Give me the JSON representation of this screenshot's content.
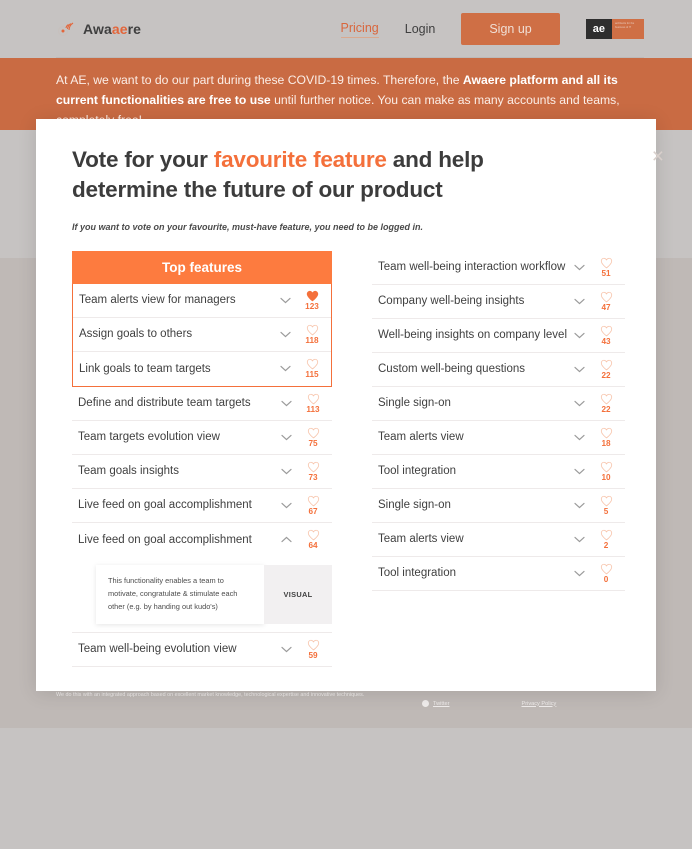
{
  "nav": {
    "brand": "Awa",
    "brand_accent": "ae",
    "brand_tail": "re",
    "pricing": "Pricing",
    "login": "Login",
    "signup": "Sign up",
    "ae_badge": "ae",
    "ae_tagline": "architects for the business of IT"
  },
  "banner": {
    "part1": "At AE, we want to do our part during these COVID-19 times. Therefore, the ",
    "bold1": "Awaere platform and all its current functionalities are free to use",
    "part2": " until further notice. You can make as many accounts and teams, completely free!"
  },
  "modal": {
    "title_part1": "Vote for your ",
    "title_accent": "favourite feature",
    "title_part2": " and help determine the future of our product",
    "subtitle": "If you want to vote on your favourite, must-have feature, you need to be logged in.",
    "close": "×",
    "top_features_header": "Top features",
    "detail": {
      "text": "This functionality enables a team to motivate, congratulate & stimulate each other (e.g. by handing out kudo's)",
      "visual_label": "VISUAL"
    },
    "left_column": [
      {
        "label": "Team alerts view for managers",
        "votes": "123",
        "voted": true,
        "expanded": false
      },
      {
        "label": "Assign goals to others",
        "votes": "118",
        "voted": false,
        "expanded": false
      },
      {
        "label": "Link goals to team targets",
        "votes": "115",
        "voted": false,
        "expanded": false
      },
      {
        "label": "Define and distribute team targets",
        "votes": "113",
        "voted": false,
        "expanded": false
      },
      {
        "label": "Team targets evolution view",
        "votes": "75",
        "voted": false,
        "expanded": false
      },
      {
        "label": "Team goals insights",
        "votes": "73",
        "voted": false,
        "expanded": false
      },
      {
        "label": "Live feed on goal accomplishment",
        "votes": "67",
        "voted": false,
        "expanded": false
      },
      {
        "label": "Live feed on goal accomplishment",
        "votes": "64",
        "voted": false,
        "expanded": true
      },
      {
        "label": "Team well-being evolution view",
        "votes": "59",
        "voted": false,
        "expanded": false
      }
    ],
    "right_column": [
      {
        "label": "Team well-being interaction workflow",
        "votes": "51",
        "voted": false
      },
      {
        "label": "Company well-being insights",
        "votes": "47",
        "voted": false
      },
      {
        "label": "Well-being insights on company level",
        "votes": "43",
        "voted": false
      },
      {
        "label": "Custom well-being questions",
        "votes": "22",
        "voted": false
      },
      {
        "label": "Single sign-on",
        "votes": "22",
        "voted": false
      },
      {
        "label": "Team alerts view",
        "votes": "18",
        "voted": false
      },
      {
        "label": "Tool integration",
        "votes": "10",
        "voted": false
      },
      {
        "label": "Single sign-on",
        "votes": "5",
        "voted": false
      },
      {
        "label": "Team alerts view",
        "votes": "2",
        "voted": false
      },
      {
        "label": "Tool integration",
        "votes": "0",
        "voted": false
      }
    ]
  },
  "footer": {
    "copy": "We do this with an integrated approach based on excellent market knowledge, technological expertise and innovative techniques.",
    "twitter": "Twitter",
    "privacy": "Privacy Policy"
  },
  "colors": {
    "accent": "#f4703b",
    "header_orange": "#fd7b3f",
    "banner_orange": "#c96b43",
    "page_gray": "#c6c3c2"
  }
}
